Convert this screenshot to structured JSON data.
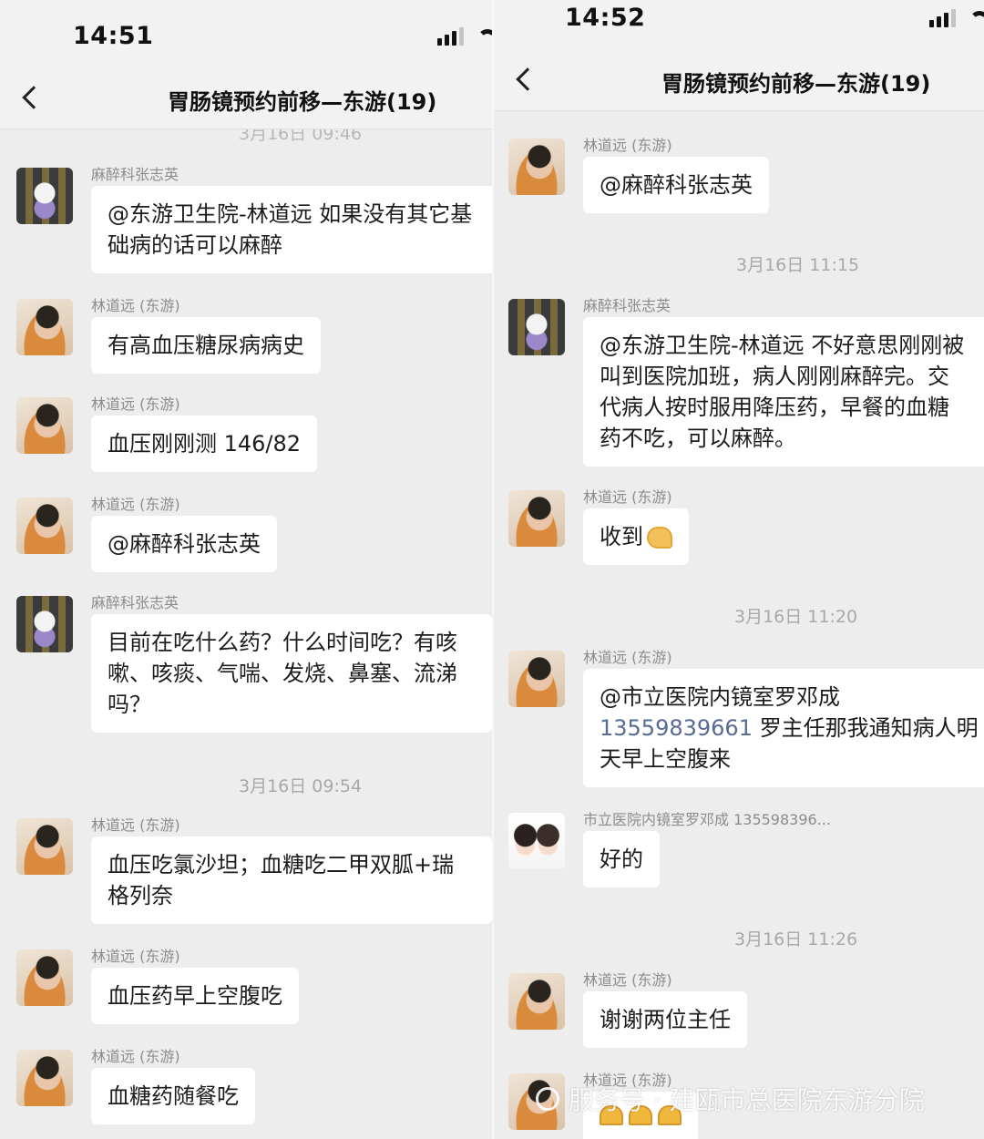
{
  "left": {
    "time": "14:51",
    "title": "胃肠镜预约前移—东游(19)",
    "top_timestamp_partial": "3月16日 09:46",
    "messages": [
      {
        "sender": "麻醉科张志英",
        "lines": [
          "@东游卫生院-林道远 如果没有其它基",
          "础病的话可以麻醉"
        ]
      },
      {
        "sender": "林道远 (东游)",
        "lines": [
          "有高血压糖尿病病史"
        ]
      },
      {
        "sender": "林道远 (东游)",
        "lines": [
          "血压刚刚测 146/82"
        ]
      },
      {
        "sender": "林道远 (东游)",
        "lines": [
          "@麻醉科张志英"
        ]
      },
      {
        "sender": "麻醉科张志英",
        "lines": [
          "目前在吃什么药？什么时间吃？有咳",
          "嗽、咳痰、气喘、发烧、鼻塞、流涕",
          "吗？"
        ]
      },
      {
        "sender": "林道远 (东游)",
        "lines": [
          "血压吃氯沙坦；血糖吃二甲双胍+瑞",
          "格列奈"
        ]
      },
      {
        "sender": "林道远 (东游)",
        "lines": [
          "血压药早上空腹吃"
        ]
      },
      {
        "sender": "林道远 (东游)",
        "lines": [
          "血糖药随餐吃"
        ]
      }
    ],
    "timestamp_2": "3月16日 09:54"
  },
  "right": {
    "time": "14:52",
    "title": "胃肠镜预约前移—东游(19)",
    "messages": [
      {
        "sender": "林道远 (东游)",
        "lines": [
          "@麻醉科张志英"
        ]
      },
      {
        "sender": "麻醉科张志英",
        "lines": [
          "@东游卫生院-林道远 不好意思刚刚被",
          "叫到医院加班，病人刚刚麻醉完。交",
          "代病人按时服用降压药，早餐的血糖",
          "药不吃，可以麻醉。"
        ]
      },
      {
        "sender": "林道远 (东游)",
        "text": "收到"
      },
      {
        "sender": "林道远 (东游)",
        "mention": "@市立医院内镜室罗邓成",
        "phone": "13559839661",
        "after_phone": " 罗主任那我通知病人明",
        "last_line": "天早上空腹来"
      },
      {
        "sender": "市立医院内镜室罗邓成 135598396...",
        "lines": [
          "好的"
        ]
      },
      {
        "sender": "林道远 (东游)",
        "lines": [
          "谢谢两位主任"
        ]
      },
      {
        "sender": "林道远 (东游)"
      }
    ],
    "timestamps": [
      "3月16日 11:15",
      "3月16日 11:20",
      "3月16日 11:26"
    ]
  },
  "watermark": "服务号 · 建瓯市总医院东游分院",
  "icons": [
    "back-icon",
    "signal-icon",
    "wifi-icon",
    "ok-hand-emoji",
    "clap-hands-emoji",
    "service-account-icon"
  ],
  "colors": {
    "background": "#ededed",
    "bubble": "#ffffff",
    "sender": "#8c8c8c",
    "timestamp": "#a8a8a8",
    "link": "#576b95"
  }
}
